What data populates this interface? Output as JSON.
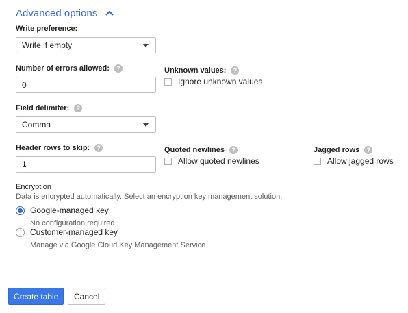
{
  "advanced": {
    "title": "Advanced options",
    "icon": "chevron-up-icon",
    "accent": "#3367d6"
  },
  "write_preference": {
    "label": "Write preference:",
    "value": "Write if empty"
  },
  "errors_allowed": {
    "label": "Number of errors allowed:",
    "value": "0"
  },
  "unknown_values": {
    "label": "Unknown values:",
    "checkbox_label": "Ignore unknown values",
    "checked": false
  },
  "field_delimiter": {
    "label": "Field delimiter:",
    "value": "Comma"
  },
  "header_rows": {
    "label": "Header rows to skip:",
    "value": "1"
  },
  "quoted_newlines": {
    "label": "Quoted newlines",
    "checkbox_label": "Allow quoted newlines",
    "checked": false
  },
  "jagged_rows": {
    "label": "Jagged rows",
    "checkbox_label": "Allow jagged rows",
    "checked": false
  },
  "help_glyph": "?",
  "encryption": {
    "title": "Encryption",
    "description": "Data is encrypted automatically. Select an encryption key management solution.",
    "options": [
      {
        "label": "Google-managed key",
        "sub": "No configuration required",
        "selected": true
      },
      {
        "label": "Customer-managed key",
        "sub": "Manage via Google Cloud Key Management Service",
        "selected": false
      }
    ]
  },
  "actions": {
    "create_label": "Create table",
    "cancel_label": "Cancel",
    "primary_color": "#3b78e7"
  }
}
